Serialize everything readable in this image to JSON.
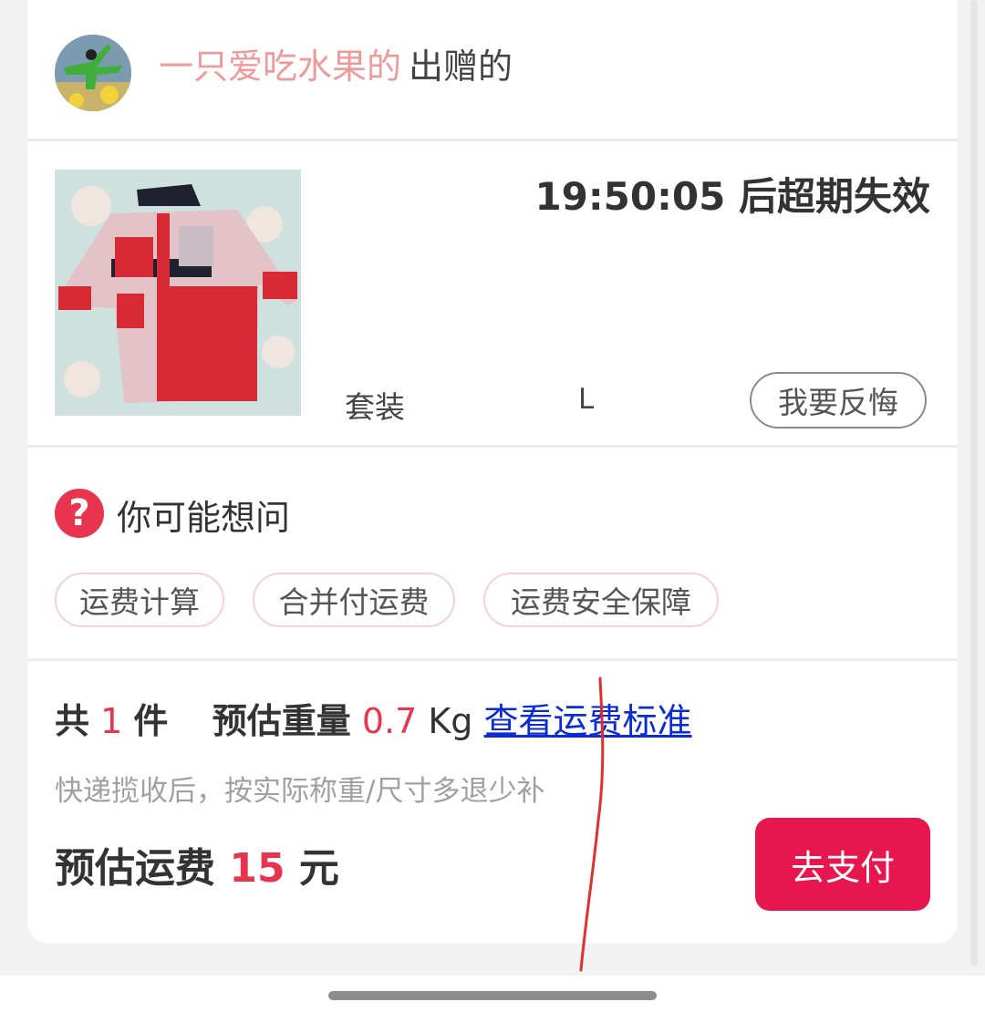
{
  "header": {
    "giver_name": "一只爱吃水果的",
    "giver_suffix": "出赠的"
  },
  "item": {
    "countdown": "19:50:05 后超期失效",
    "name": "套装",
    "size": "L",
    "regret_label": "我要反悔"
  },
  "faq": {
    "title": "你可能想问",
    "chips": [
      "运费计算",
      "合并付运费",
      "运费安全保障"
    ]
  },
  "shipping": {
    "count_prefix": "共",
    "count": "1",
    "count_suffix": "件",
    "weight_label": "预估重量",
    "weight_value": "0.7",
    "weight_unit": "Kg",
    "standard_link": "查看运费标准",
    "note": "快递揽收后，按实际称重/尺寸多退少补",
    "fee_label": "预估运费",
    "fee_value": "15",
    "fee_unit": "元",
    "pay_label": "去支付"
  },
  "colors": {
    "accent": "#e8344e",
    "pay_button": "#e8164f",
    "giver_name": "#ef9a9a",
    "link": "#0b2bd6",
    "annotation_stroke": "#e0302e"
  }
}
